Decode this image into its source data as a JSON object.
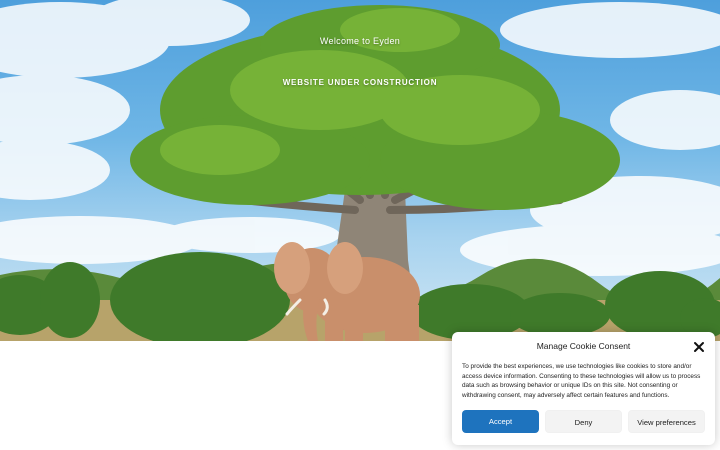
{
  "hero": {
    "title": "Welcome to Eyden",
    "heading": "WEBSITE UNDER CONSTRUCTION"
  },
  "cookie_banner": {
    "title": "Manage Cookie Consent",
    "text": "To provide the best experiences, we use technologies like cookies to store and/or access device information. Consenting to these technologies will allow us to process data such as browsing behavior or unique IDs on this site. Not consenting or withdrawing consent, may adversely affect certain features and functions.",
    "accept_label": "Accept",
    "deny_label": "Deny",
    "preferences_label": "View preferences",
    "close_icon": "close-icon"
  },
  "colors": {
    "accent": "#1e73be",
    "button_neutral": "#f3f3f3"
  }
}
